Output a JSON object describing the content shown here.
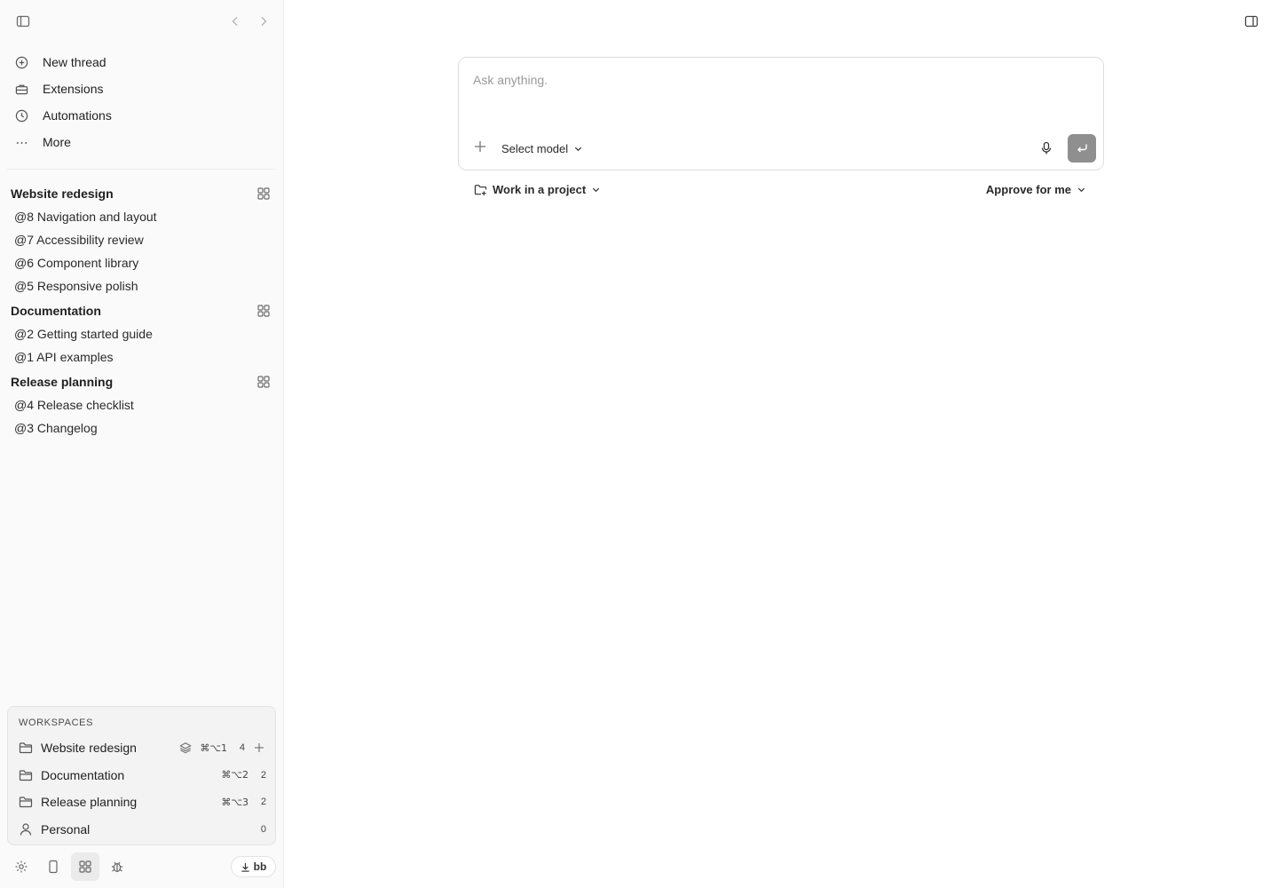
{
  "nav": {
    "items": [
      {
        "label": "New thread",
        "icon": "plus-circle-icon"
      },
      {
        "label": "Extensions",
        "icon": "toolbox-icon"
      },
      {
        "label": "Automations",
        "icon": "clock-icon"
      },
      {
        "label": "More",
        "icon": "ellipsis-icon"
      }
    ]
  },
  "groups": [
    {
      "title": "Website redesign",
      "threads": [
        "@8 Navigation and layout",
        "@7 Accessibility review",
        "@6 Component library",
        "@5 Responsive polish"
      ]
    },
    {
      "title": "Documentation",
      "threads": [
        "@2 Getting started guide",
        "@1 API examples"
      ]
    },
    {
      "title": "Release planning",
      "threads": [
        "@4 Release checklist",
        "@3 Changelog"
      ]
    }
  ],
  "workspaces": {
    "title": "WORKSPACES",
    "rows": [
      {
        "name": "Website redesign",
        "shortcut": "⌘⌥1",
        "count": "4",
        "icon": "folder-icon"
      },
      {
        "name": "Documentation",
        "shortcut": "⌘⌥2",
        "count": "2",
        "icon": "folder-icon"
      },
      {
        "name": "Release planning",
        "shortcut": "⌘⌥3",
        "count": "2",
        "icon": "folder-icon"
      },
      {
        "name": "Personal",
        "shortcut": "",
        "count": "0",
        "icon": "person-icon"
      }
    ]
  },
  "footer": {
    "install_label": "bb"
  },
  "composer": {
    "placeholder": "Ask anything.",
    "model_label": "Select model"
  },
  "options": {
    "project_label": "Work in a project",
    "approve_label": "Approve for me"
  },
  "colors": {
    "sidebar_bg": "#fafafa",
    "send_button": "#8f8f8f",
    "border": "#dedede"
  }
}
